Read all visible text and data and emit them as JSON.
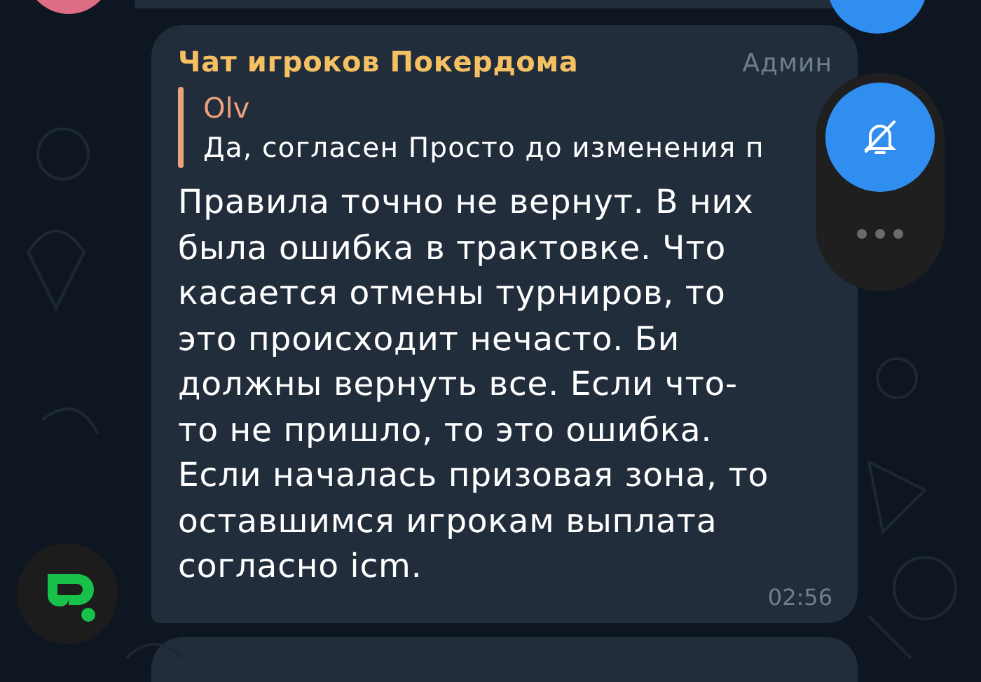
{
  "message": {
    "sender": "Чат игроков Покердома",
    "badge": "Админ",
    "reply": {
      "author": "Olv",
      "text": "Да, согласен Просто до изменения п"
    },
    "text": "Правила точно не вернут. В них была ошибка в трактовке. Что касается отмены турниров, то это происходит нечасто. Би должны вернуть все. Если что-то не пришло, то это ошибка. Если началась призовая зона, то оставшимся игрокам выплата согласно icm.",
    "time": "02:56"
  },
  "side_panel": {
    "muted": true
  }
}
